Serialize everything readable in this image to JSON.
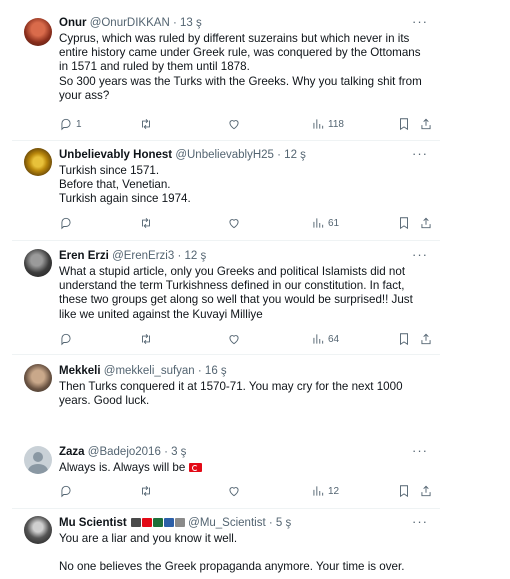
{
  "tweets": [
    {
      "name": "Onur",
      "handle": "@OnurDIKKAN",
      "time": "· 13 ş",
      "text": "Cyprus, which was ruled by different suzerains but which never in its entire history came under Greek rule, was conquered by the Ottomans in 1571 and ruled by them until 1878.\nSo 300 years was the Turks with the Greeks. Why you talking shit from your ass?",
      "replies": "1",
      "views": "118"
    },
    {
      "name": "Unbelievably Honest",
      "handle": "@UnbelievablyH25",
      "time": "· 12 ş",
      "text": "Turkish since 1571.\nBefore that, Venetian.\nTurkish again since 1974.",
      "replies": "",
      "views": "61"
    },
    {
      "name": "Eren Erzi",
      "handle": "@ErenErzi3",
      "time": "· 12 ş",
      "text": "What a stupid article, only you Greeks and political Islamists did not understand the term Turkishness defined in our constitution. In fact, these two groups get along so well that you would be surprised!! Just like we united against the Kuvayi Milliye",
      "replies": "",
      "views": "64"
    },
    {
      "name": "Mekkeli",
      "handle": "@mekkeli_sufyan",
      "time": "· 16 ş",
      "text": "Then Turks conquered it at 1570-71. You may cry for the next 1000 years. Good luck."
    },
    {
      "name": "Zaza",
      "handle": "@Badejo2016",
      "time": "· 3 ş",
      "text": "Always is. Always will be",
      "replies": "",
      "views": "12"
    },
    {
      "name": "Mu Scientist",
      "handle": "@Mu_Scientist",
      "time": "· 5 ş",
      "text": "You are a liar and you know it well.\n\nNo one believes the Greek propaganda anymore. Your time is over."
    }
  ],
  "more_label": "···",
  "icons": {
    "reply": "reply-icon",
    "retweet": "retweet-icon",
    "like": "like-icon",
    "views": "views-icon",
    "bookmark": "bookmark-icon",
    "share": "share-icon"
  }
}
